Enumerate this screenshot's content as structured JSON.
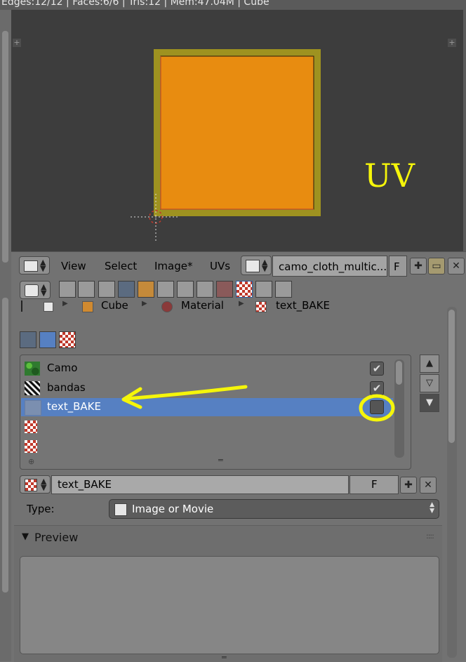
{
  "status_bar": {
    "text": "Edges:12/12 | Faces:6/6 | Tris:12 | Mem:47.04M | Cube"
  },
  "uv_view": {
    "label": "UV",
    "face_color": "#e88c10",
    "frame_color": "#9e9220"
  },
  "image_header": {
    "menu": [
      "View",
      "Select",
      "Image*",
      "UVs"
    ],
    "image_name": "camo_cloth_multic...",
    "fake_user": "F"
  },
  "breadcrumb": {
    "object": "Cube",
    "material": "Material",
    "texture": "text_BAKE"
  },
  "texture_slots": [
    {
      "name": "Camo",
      "enabled": true,
      "thumb": "camo"
    },
    {
      "name": "bandas",
      "enabled": true,
      "thumb": "stripes"
    },
    {
      "name": "text_BAKE",
      "enabled": false,
      "thumb": "blank",
      "selected": true
    },
    {
      "name": "",
      "thumb": "checker"
    },
    {
      "name": "",
      "thumb": "checker"
    }
  ],
  "texture_datablock": {
    "name": "text_BAKE",
    "fake_user": "F"
  },
  "type_field": {
    "label": "Type:",
    "value": "Image or Movie"
  },
  "preview": {
    "label": "Preview"
  },
  "annotation": {
    "color": "#f5f50a"
  }
}
